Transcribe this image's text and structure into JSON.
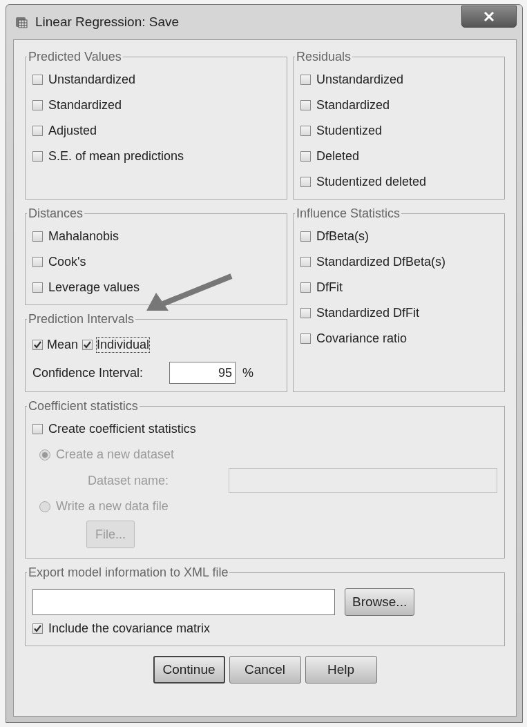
{
  "window": {
    "title": "Linear Regression: Save"
  },
  "predicted_values": {
    "title": "Predicted Values",
    "items": [
      {
        "label": "Unstandardized",
        "checked": false
      },
      {
        "label": "Standardized",
        "checked": false
      },
      {
        "label": "Adjusted",
        "checked": false
      },
      {
        "label": "S.E. of mean predictions",
        "checked": false
      }
    ]
  },
  "residuals": {
    "title": "Residuals",
    "items": [
      {
        "label": "Unstandardized",
        "checked": false
      },
      {
        "label": "Standardized",
        "checked": false
      },
      {
        "label": "Studentized",
        "checked": false
      },
      {
        "label": "Deleted",
        "checked": false
      },
      {
        "label": "Studentized deleted",
        "checked": false
      }
    ]
  },
  "distances": {
    "title": "Distances",
    "items": [
      {
        "label": "Mahalanobis",
        "checked": false
      },
      {
        "label": "Cook's",
        "checked": false
      },
      {
        "label": "Leverage values",
        "checked": false
      }
    ]
  },
  "influence_statistics": {
    "title": "Influence Statistics",
    "items": [
      {
        "label": "DfBeta(s)",
        "checked": false
      },
      {
        "label": "Standardized DfBeta(s)",
        "checked": false
      },
      {
        "label": "DfFit",
        "checked": false
      },
      {
        "label": "Standardized DfFit",
        "checked": false
      },
      {
        "label": "Covariance ratio",
        "checked": false
      }
    ]
  },
  "prediction_intervals": {
    "title": "Prediction Intervals",
    "items": [
      {
        "label": "Mean",
        "checked": true,
        "focused": false
      },
      {
        "label": "Individual",
        "checked": true,
        "focused": true
      }
    ],
    "confidence_label": "Confidence Interval:",
    "confidence_value": "95",
    "unit": "%"
  },
  "coefficient_statistics": {
    "title": "Coefficient statistics",
    "create": {
      "label": "Create coefficient statistics",
      "checked": false
    },
    "options": [
      {
        "label": "Create a new dataset",
        "selected": true,
        "disabled": true
      },
      {
        "label": "Write a new data file",
        "selected": false,
        "disabled": true
      }
    ],
    "dataset_name": {
      "label": "Dataset name:",
      "disabled": true
    },
    "file_button": {
      "label": "File...",
      "disabled": true
    }
  },
  "export_xml": {
    "title": "Export model information to XML file",
    "browse_button": "Browse...",
    "include": {
      "label": "Include the covariance matrix",
      "checked": true
    }
  },
  "buttons": [
    {
      "label": "Continue",
      "default": true
    },
    {
      "label": "Cancel",
      "default": false
    },
    {
      "label": "Help",
      "default": false
    }
  ]
}
